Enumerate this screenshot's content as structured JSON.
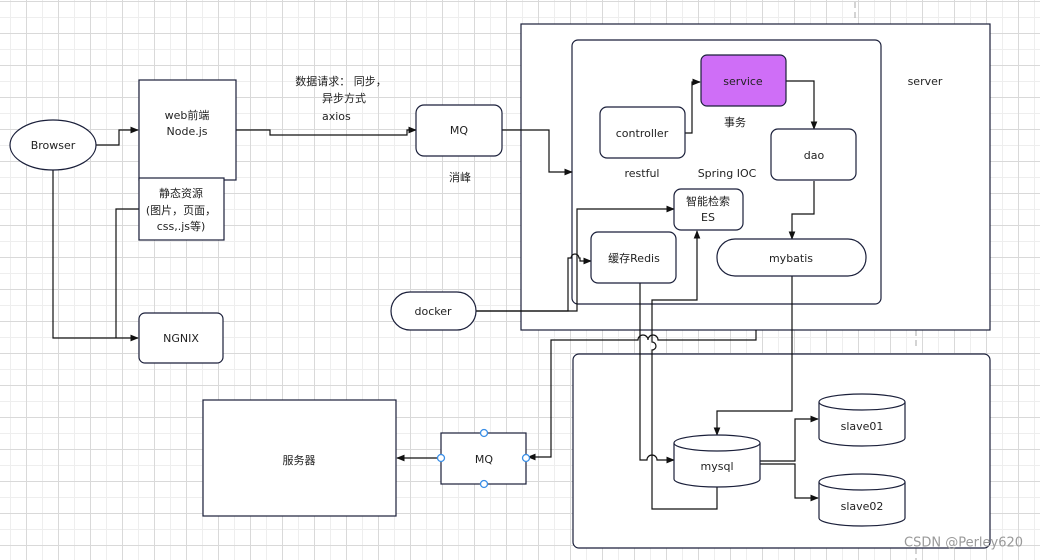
{
  "diagram": {
    "nodes": {
      "browser": "Browser",
      "web_frontend": [
        "web前端",
        "Node.js"
      ],
      "static_resources": [
        "静态资源",
        "(图片，页面，",
        "css,.js等)"
      ],
      "nginx": "NGNIX",
      "request_note": [
        "数据请求：  同步，",
        "异步方式",
        "axios"
      ],
      "mq_top": "MQ",
      "mq_top_caption": "消峰",
      "docker": "docker",
      "server_label": "server",
      "controller": "controller",
      "controller_caption": "restful",
      "service": "service",
      "service_caption": "事务",
      "spring_ioc": "Spring IOC",
      "dao": "dao",
      "es": [
        "智能检索",
        "ES"
      ],
      "redis": "缓存Redis",
      "mybatis": "mybatis",
      "mysql": "mysql",
      "slave01": "slave01",
      "slave02": "slave02",
      "server_machine": "服务器",
      "mq_bottom": "MQ"
    },
    "colors": {
      "service_fill": "#cf6ef7",
      "stroke": "#1a1f3a",
      "handle": "#3a8ee6"
    },
    "watermark": "CSDN @Perley620"
  }
}
